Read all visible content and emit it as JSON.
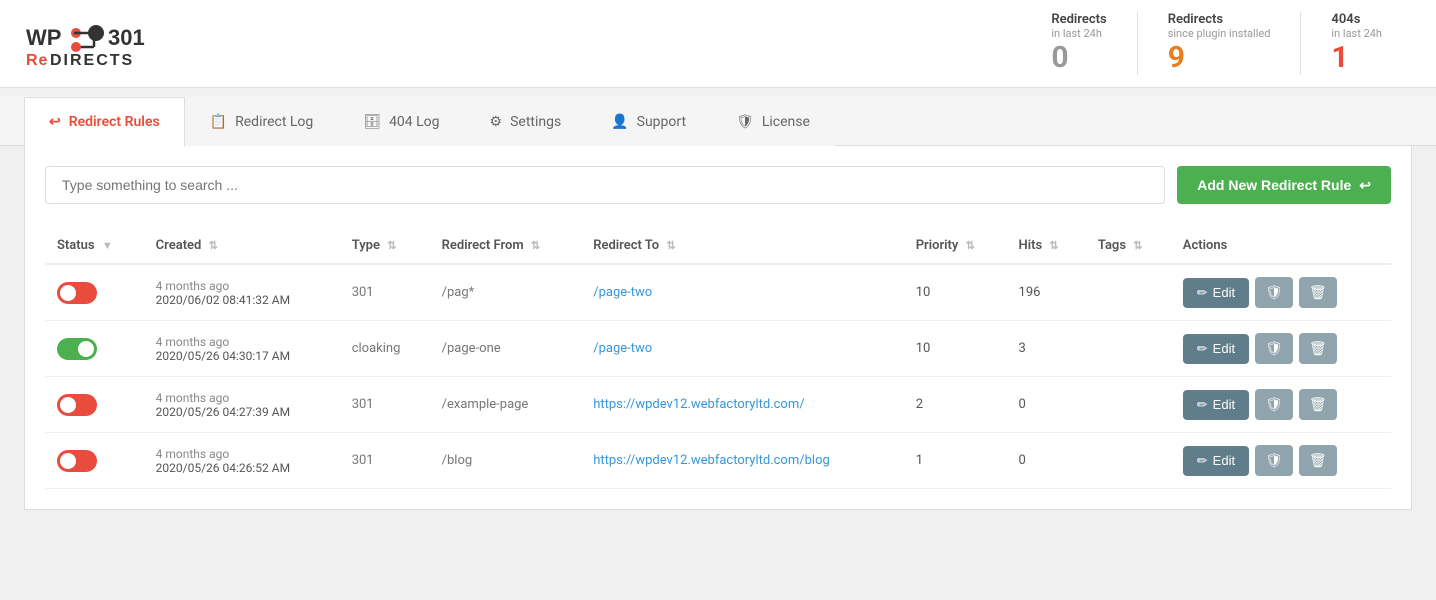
{
  "header": {
    "logo_line1": "WP 301",
    "logo_line2": "ReDIRECTS",
    "stats": [
      {
        "label": "Redirects",
        "sublabel": "in last 24h",
        "value": "0",
        "color": "gray"
      },
      {
        "label": "Redirects",
        "sublabel": "since plugin installed",
        "value": "9",
        "color": "orange"
      },
      {
        "label": "404s",
        "sublabel": "in last 24h",
        "value": "1",
        "color": "red"
      }
    ]
  },
  "tabs": [
    {
      "id": "redirect-rules",
      "label": "Redirect Rules",
      "icon": "↩",
      "active": true
    },
    {
      "id": "redirect-log",
      "label": "Redirect Log",
      "icon": "📋",
      "active": false
    },
    {
      "id": "404-log",
      "label": "404 Log",
      "icon": "🗄",
      "active": false
    },
    {
      "id": "settings",
      "label": "Settings",
      "icon": "⚙",
      "active": false
    },
    {
      "id": "support",
      "label": "Support",
      "icon": "👤",
      "active": false
    },
    {
      "id": "license",
      "label": "License",
      "icon": "🛡",
      "active": false
    }
  ],
  "toolbar": {
    "search_placeholder": "Type something to search ...",
    "add_button_label": "Add New Redirect Rule"
  },
  "table": {
    "columns": [
      {
        "key": "status",
        "label": "Status",
        "sortable": true
      },
      {
        "key": "created",
        "label": "Created",
        "sortable": true
      },
      {
        "key": "type",
        "label": "Type",
        "sortable": true
      },
      {
        "key": "redirect_from",
        "label": "Redirect From",
        "sortable": true
      },
      {
        "key": "redirect_to",
        "label": "Redirect To",
        "sortable": true
      },
      {
        "key": "priority",
        "label": "Priority",
        "sortable": true
      },
      {
        "key": "hits",
        "label": "Hits",
        "sortable": true
      },
      {
        "key": "tags",
        "label": "Tags",
        "sortable": true
      },
      {
        "key": "actions",
        "label": "Actions",
        "sortable": false
      }
    ],
    "rows": [
      {
        "id": 1,
        "enabled": false,
        "status_color": "red",
        "created_ago": "4 months ago",
        "created_full": "2020/06/02 08:41:32 AM",
        "type": "301",
        "redirect_from": "/pag*",
        "redirect_to": "/page-two",
        "priority": "10",
        "hits": "196",
        "tags": ""
      },
      {
        "id": 2,
        "enabled": true,
        "status_color": "green",
        "created_ago": "4 months ago",
        "created_full": "2020/05/26 04:30:17 AM",
        "type": "cloaking",
        "redirect_from": "/page-one",
        "redirect_to": "/page-two",
        "priority": "10",
        "hits": "3",
        "tags": ""
      },
      {
        "id": 3,
        "enabled": false,
        "status_color": "red",
        "created_ago": "4 months ago",
        "created_full": "2020/05/26 04:27:39 AM",
        "type": "301",
        "redirect_from": "/example-page",
        "redirect_to": "https://wpdev12.webfactoryltd.com/",
        "priority": "2",
        "hits": "0",
        "tags": ""
      },
      {
        "id": 4,
        "enabled": false,
        "status_color": "red",
        "created_ago": "4 months ago",
        "created_full": "2020/05/26 04:26:52 AM",
        "type": "301",
        "redirect_from": "/blog",
        "redirect_to": "https://wpdev12.webfactoryltd.com/blog",
        "priority": "1",
        "hits": "0",
        "tags": ""
      }
    ]
  },
  "colors": {
    "red": "#e74c3c",
    "green": "#4caf50",
    "orange": "#e67e22",
    "gray": "#999",
    "blue": "#3498db",
    "edit_btn": "#607d8b",
    "icon_btn": "#90a4ae",
    "add_btn": "#4caf50"
  }
}
